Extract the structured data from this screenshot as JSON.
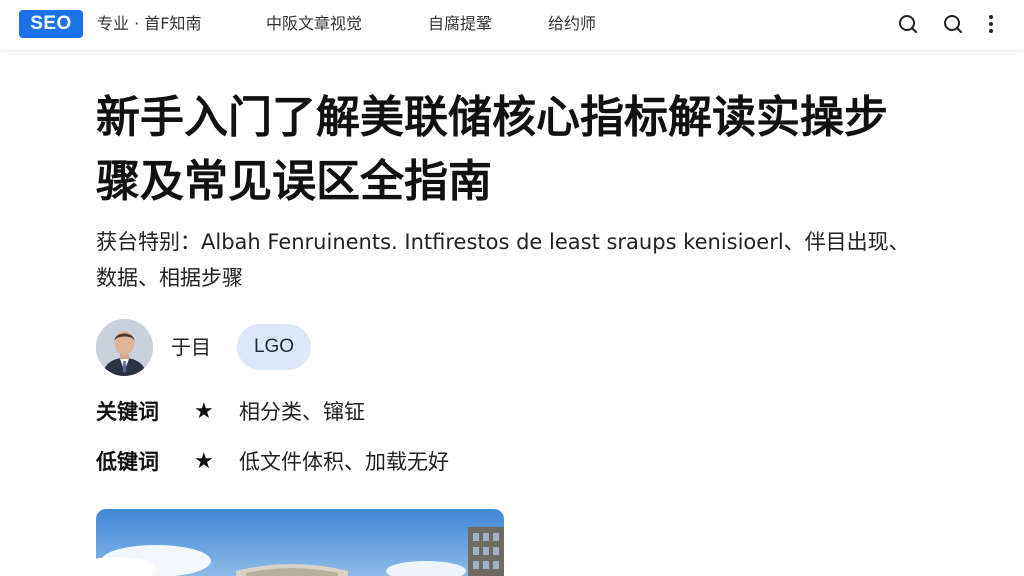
{
  "header": {
    "logo": "SEO",
    "nav": [
      "专业 · 首F知南",
      "中阪文章视觉",
      "自腐提鞏",
      "给约师"
    ],
    "icons": [
      "search-icon",
      "search-icon",
      "more-vertical-icon"
    ]
  },
  "article": {
    "title": "新手入门了解美联储核心指标解读实操步骤及常见误区全指南",
    "summary": "获台特别：Albah Fenruinents. Intfirestos de least sraups kenisioerl、伴目出现、数据、相据步骤",
    "author": {
      "name": "于目",
      "badge": "LGO"
    },
    "keywords": [
      {
        "label": "关键词",
        "star": "★",
        "value": "相分类、镩钲"
      },
      {
        "label": "低键词",
        "star": "★",
        "value": "低文件体积、加载无好"
      }
    ]
  },
  "colors": {
    "brand": "#1a73e8",
    "badge_bg": "#dce8f8",
    "text": "#111111"
  }
}
